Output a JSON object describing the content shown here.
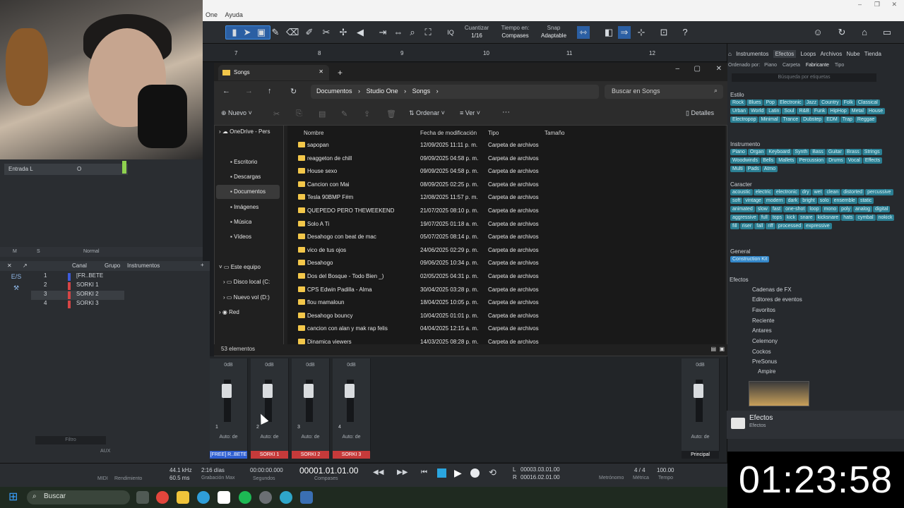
{
  "menu": [
    "One",
    "Ayuda"
  ],
  "toolbar": {
    "quantize_label": "Cuantizar",
    "quantize_value": "1/16",
    "timebase_label": "Tiempo en:",
    "timebase_value": "Compases",
    "snap_label": "Snap",
    "snap_value": "Adaptable",
    "iq_label": "IQ"
  },
  "ruler": [
    "7",
    "8",
    "9",
    "10",
    "11",
    "12"
  ],
  "inspector": {
    "input": "Entrada L",
    "input_val": "O",
    "m": "M",
    "s": "S",
    "mode": "Normal"
  },
  "tracks_header": {
    "col1": "E/S",
    "col2": "Canal",
    "col3": "Grupo",
    "col4": "Instrumentos"
  },
  "tracks": [
    {
      "num": "1",
      "name": "[FR..BETE",
      "color": "#3d5bd9"
    },
    {
      "num": "2",
      "name": "SORKI 1",
      "color": "#d64545"
    },
    {
      "num": "3",
      "name": "SORKI 2",
      "color": "#d64545"
    },
    {
      "num": "4",
      "name": "SORKI 3",
      "color": "#d64545"
    }
  ],
  "left_filter": "Filtro",
  "left_footer": "AUX",
  "mixer": {
    "channels": [
      {
        "db": "0dB",
        "num": "1",
        "auto": "Auto: de",
        "name": "[FREE] R..BETE",
        "color": "#2f5fd1"
      },
      {
        "db": "0dB",
        "num": "2",
        "auto": "Auto: de",
        "name": "SORKI 1",
        "color": "#c63a3a"
      },
      {
        "db": "0dB",
        "num": "3",
        "auto": "Auto: de",
        "name": "SORKI 2",
        "color": "#c63a3a"
      },
      {
        "db": "0dB",
        "num": "4",
        "auto": "Auto: de",
        "name": "SORKI 3",
        "color": "#c63a3a"
      }
    ],
    "main": {
      "db": "0dB",
      "auto": "Auto: de",
      "name": "Principal"
    }
  },
  "browser": {
    "tabs": [
      "Instrumentos",
      "Efectos",
      "Loops",
      "Archivos",
      "Nube",
      "Tienda"
    ],
    "active_tab": "Efectos",
    "sort": [
      "Ordenado por:",
      "Piano",
      "Carpeta",
      "Fabricante",
      "Tipo"
    ],
    "search_placeholder": "Búsqueda por etiquetas",
    "estilo_label": "Estilo",
    "estilo": [
      "Rock",
      "Blues",
      "Pop",
      "Electronic",
      "Jazz",
      "Country",
      "Folk",
      "Classical",
      "Urban",
      "World",
      "Latin",
      "Soul",
      "R&B",
      "Funk",
      "HipHop",
      "Metal",
      "House",
      "Electropop",
      "Minimal",
      "Trance",
      "Dubstep",
      "EDM",
      "Trap",
      "Reggae"
    ],
    "instrumento_label": "Instrumento",
    "instrumento": [
      "Piano",
      "Organ",
      "Keyboard",
      "Synth",
      "Bass",
      "Guitar",
      "Brass",
      "Strings",
      "Woodwinds",
      "Bells",
      "Mallets",
      "Percussion",
      "Drums",
      "Vocal",
      "Effects",
      "Multi",
      "Pads",
      "Atmo"
    ],
    "caracter_label": "Caracter",
    "caracter": [
      "acoustic",
      "electric",
      "electronic",
      "dry",
      "wet",
      "clean",
      "distorted",
      "percussive",
      "soft",
      "vintage",
      "modern",
      "dark",
      "bright",
      "solo",
      "ensemble",
      "static",
      "animated",
      "slow",
      "fast",
      "one-shot",
      "loop",
      "mono",
      "poly",
      "analog",
      "digital",
      "aggressive",
      "full",
      "tops",
      "kick",
      "snare",
      "kicksnare",
      "hats",
      "cymbal",
      "nokick",
      "fill",
      "riser",
      "fall",
      "riff",
      "processed",
      "expressive"
    ],
    "general_label": "General",
    "general": [
      "Construction Kit"
    ],
    "tree_root": "Efectos",
    "tree": [
      "Cadenas de FX",
      "Editores de eventos",
      "Favoritos",
      "Reciente",
      "Antares",
      "Celemony",
      "Cockos",
      "PreSonus",
      "Ampire"
    ],
    "footer_title": "Efectos",
    "footer_sub": "Efectos"
  },
  "transport": {
    "midi": "MIDI",
    "perf": "Rendimiento",
    "rate": "44.1 kHz",
    "latency": "60.5 ms",
    "days": "2:16 días",
    "rec_max": "Grabación Max",
    "seconds": "00:00:00.000",
    "seconds_label": "Segundos",
    "bars": "00001.01.01.00",
    "bars_label": "Compases",
    "loop_l": "00003.03.01.00",
    "loop_r": "00016.02.01.00",
    "l": "L",
    "r": "R",
    "metronome": "Metrónomo",
    "sig": "4 / 4",
    "sig_label": "Métrica",
    "tempo": "100.00",
    "tempo_label": "Tempo"
  },
  "clock": "01:23:58",
  "taskbar": {
    "search": "Buscar"
  },
  "explorer": {
    "tab": "Songs",
    "crumbs": [
      "Documentos",
      "Studio One",
      "Songs"
    ],
    "search_placeholder": "Buscar en Songs",
    "new": "Nuevo",
    "sort": "Ordenar",
    "view": "Ver",
    "details": "Detalles",
    "nav": [
      "OneDrive - Pers",
      "Escritorio",
      "Descargas",
      "Documentos",
      "Imágenes",
      "Música",
      "Vídeos",
      "Este equipo",
      "Disco local (C:",
      "Nuevo vol (D:)",
      "Red"
    ],
    "columns": [
      "Nombre",
      "Fecha de modificación",
      "Tipo",
      "Tamaño"
    ],
    "files": [
      {
        "n": "sapopan",
        "d": "12/09/2025 11:11 p. m.",
        "t": "Carpeta de archivos"
      },
      {
        "n": "reaggeton de chill",
        "d": "09/09/2025 04:58 p. m.",
        "t": "Carpeta de archivos"
      },
      {
        "n": "House sexo",
        "d": "09/09/2025 04:58 p. m.",
        "t": "Carpeta de archivos"
      },
      {
        "n": "Cancion con Mai",
        "d": "08/09/2025 02:25 p. m.",
        "t": "Carpeta de archivos"
      },
      {
        "n": "Tesla 90BMP F#m",
        "d": "12/08/2025 11:57 p. m.",
        "t": "Carpeta de archivos"
      },
      {
        "n": "QUEPEDO PERO THEWEEKEND",
        "d": "21/07/2025 08:10 p. m.",
        "t": "Carpeta de archivos"
      },
      {
        "n": "Solo A Ti",
        "d": "19/07/2025 01:18 a. m.",
        "t": "Carpeta de archivos"
      },
      {
        "n": "Desahogo con beat de mac",
        "d": "05/07/2025 08:14 p. m.",
        "t": "Carpeta de archivos"
      },
      {
        "n": "vico de tus ojos",
        "d": "24/06/2025 02:29 p. m.",
        "t": "Carpeta de archivos"
      },
      {
        "n": "Desahogo",
        "d": "09/06/2025 10:34 p. m.",
        "t": "Carpeta de archivos"
      },
      {
        "n": "Dos del Bosque - Todo Bien _)",
        "d": "02/05/2025 04:31 p. m.",
        "t": "Carpeta de archivos"
      },
      {
        "n": "CPS Edwin Padilla - Alma",
        "d": "30/04/2025 03:28 p. m.",
        "t": "Carpeta de archivos"
      },
      {
        "n": "flou mamaloun",
        "d": "18/04/2025 10:05 p. m.",
        "t": "Carpeta de archivos"
      },
      {
        "n": "Desahogo bouncy",
        "d": "10/04/2025 01:01 p. m.",
        "t": "Carpeta de archivos"
      },
      {
        "n": "cancion con alan y mak rap felis",
        "d": "04/04/2025 12:15 a. m.",
        "t": "Carpeta de archivos"
      },
      {
        "n": "Dinamica viewers",
        "d": "14/03/2025 08:28 p. m.",
        "t": "Carpeta de archivos"
      }
    ],
    "status": "53 elementos"
  }
}
